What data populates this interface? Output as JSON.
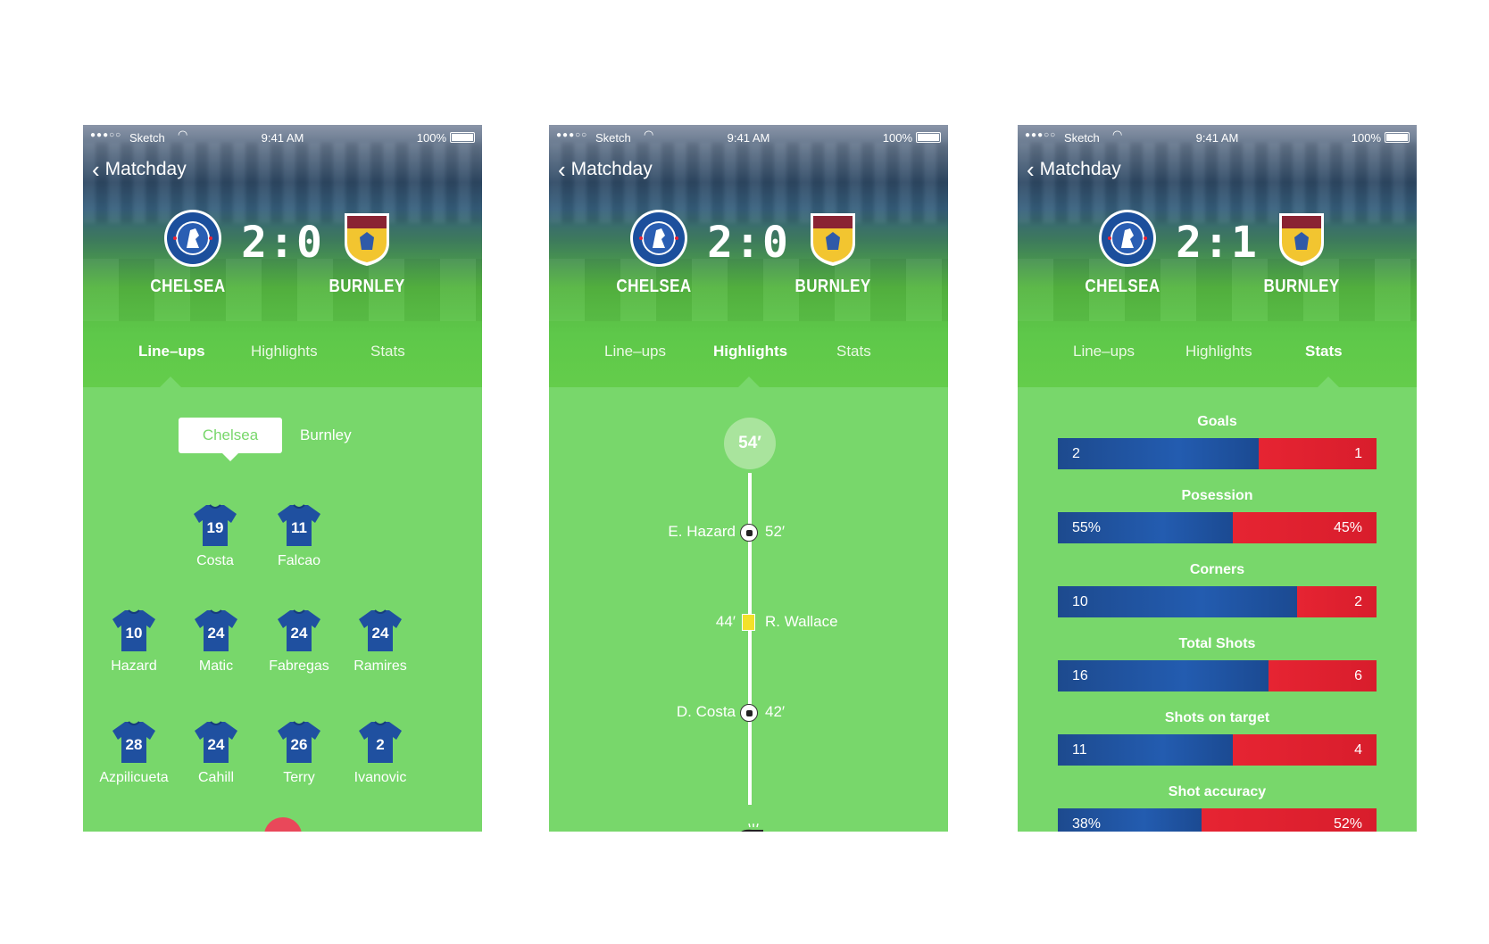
{
  "screens": [
    {
      "status": {
        "carrier": "Sketch",
        "time": "9:41 AM",
        "battery": "100%",
        "signal": "●●●○○"
      },
      "nav_back": "Matchday",
      "score": "2:0",
      "home_team": "CHELSEA",
      "away_team": "BURNLEY",
      "tabs": [
        "Line–ups",
        "Highlights",
        "Stats"
      ],
      "active_tab": 0
    },
    {
      "status": {
        "carrier": "Sketch",
        "time": "9:41 AM",
        "battery": "100%",
        "signal": "●●●○○"
      },
      "nav_back": "Matchday",
      "score": "2:0",
      "home_team": "CHELSEA",
      "away_team": "BURNLEY",
      "tabs": [
        "Line–ups",
        "Highlights",
        "Stats"
      ],
      "active_tab": 1
    },
    {
      "status": {
        "carrier": "Sketch",
        "time": "9:41 AM",
        "battery": "100%",
        "signal": "●●●○○"
      },
      "nav_back": "Matchday",
      "score": "2:1",
      "home_team": "CHELSEA",
      "away_team": "BURNLEY",
      "tabs": [
        "Line–ups",
        "Highlights",
        "Stats"
      ],
      "active_tab": 2
    }
  ],
  "lineups": {
    "segments": [
      "Chelsea",
      "Burnley"
    ],
    "selected_segment": "Chelsea",
    "players": [
      {
        "number": "19",
        "name": "Costa"
      },
      {
        "number": "11",
        "name": "Falcao"
      },
      {
        "number": "10",
        "name": "Hazard"
      },
      {
        "number": "24",
        "name": "Matic"
      },
      {
        "number": "24",
        "name": "Fabregas"
      },
      {
        "number": "24",
        "name": "Ramires"
      },
      {
        "number": "28",
        "name": "Azpilicueta"
      },
      {
        "number": "24",
        "name": "Cahill"
      },
      {
        "number": "26",
        "name": "Terry"
      },
      {
        "number": "2",
        "name": "Ivanovic"
      }
    ]
  },
  "highlights": {
    "current_minute": "54′",
    "events": [
      {
        "side": "home",
        "player": "E. Hazard",
        "minute": "52′",
        "type": "goal"
      },
      {
        "side": "away",
        "player": "R. Wallace",
        "minute": "44′",
        "type": "yellow-card"
      },
      {
        "side": "home",
        "player": "D. Costa",
        "minute": "42′",
        "type": "goal"
      }
    ]
  },
  "stats": [
    {
      "label": "Goals",
      "home": "2",
      "away": "1",
      "home_share": 0.63
    },
    {
      "label": "Posession",
      "home": "55%",
      "away": "45%",
      "home_share": 0.55
    },
    {
      "label": "Corners",
      "home": "10",
      "away": "2",
      "home_share": 0.75
    },
    {
      "label": "Total Shots",
      "home": "16",
      "away": "6",
      "home_share": 0.66
    },
    {
      "label": "Shots on target",
      "home": "11",
      "away": "4",
      "home_share": 0.55
    },
    {
      "label": "Shot accuracy",
      "home": "38%",
      "away": "52%",
      "home_share": 0.45
    }
  ],
  "colors": {
    "pitch_green": "#78d76b",
    "chelsea_blue": "#1f50a0",
    "burnley_red": "#e02230",
    "card_yellow": "#f3e12a"
  }
}
